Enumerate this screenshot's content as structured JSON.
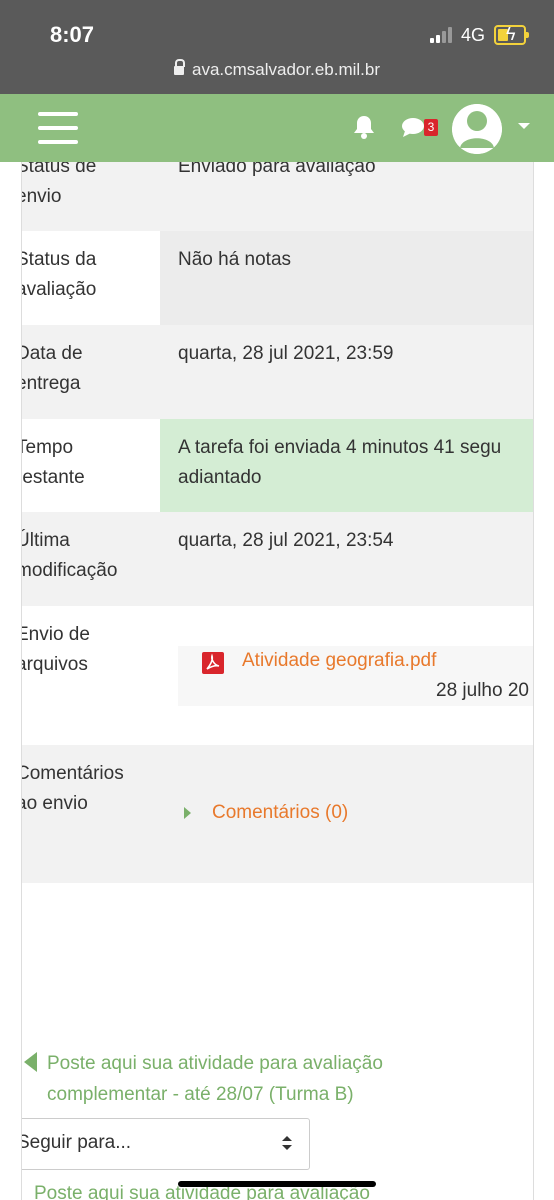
{
  "status_bar": {
    "time": "8:07",
    "network": "4G",
    "url": "ava.cmsalvador.eb.mil.br"
  },
  "navbar": {
    "notifications_icon": "bell-icon",
    "messages_icon": "chat-icon",
    "messages_badge": "3",
    "menu_icon": "hamburger-icon",
    "user_icon": "user-avatar-icon"
  },
  "submission_status": {
    "rows": [
      {
        "label_line1": "Status de",
        "label_line2": "envio",
        "value_line1": "Enviado para avaliação",
        "value_line2": ""
      },
      {
        "label_line1": "Status da",
        "label_line2": "avaliação",
        "value_line1": "Não há notas",
        "value_line2": ""
      },
      {
        "label_line1": "Data de",
        "label_line2": "entrega",
        "value_line1": "quarta, 28 jul 2021, 23:59",
        "value_line2": ""
      },
      {
        "label_line1": "Tempo",
        "label_line2": "restante",
        "value_line1": "A tarefa foi enviada 4 minutos 41 segu",
        "value_line2": "adiantado"
      },
      {
        "label_line1": "Última",
        "label_line2": "modificação",
        "value_line1": "quarta, 28 jul 2021, 23:54",
        "value_line2": ""
      },
      {
        "label_line1": "Envio de",
        "label_line2": "arquivos",
        "value_line1": "",
        "value_line2": ""
      },
      {
        "label_line1": "Comentários",
        "label_line2": "ao envio",
        "value_line1": "",
        "value_line2": ""
      }
    ],
    "file": {
      "name": "Atividade geografia.pdf",
      "date": "28 julho 20",
      "icon": "pdf-icon"
    },
    "comments_link": "Comentários (0)"
  },
  "navigation": {
    "previous_activity_line1": "Poste aqui sua atividade para avaliação",
    "previous_activity_line2": "complementar - até 28/07  (Turma B)",
    "jump_select": "Seguir para...",
    "next_activity": "Poste aqui sua atividade para avaliação"
  },
  "colors": {
    "navbar": "#8fbf80",
    "link_orange": "#e8792c",
    "link_green": "#7ab06a",
    "success_bg": "#d4edd4",
    "badge_red": "#d9262c"
  }
}
